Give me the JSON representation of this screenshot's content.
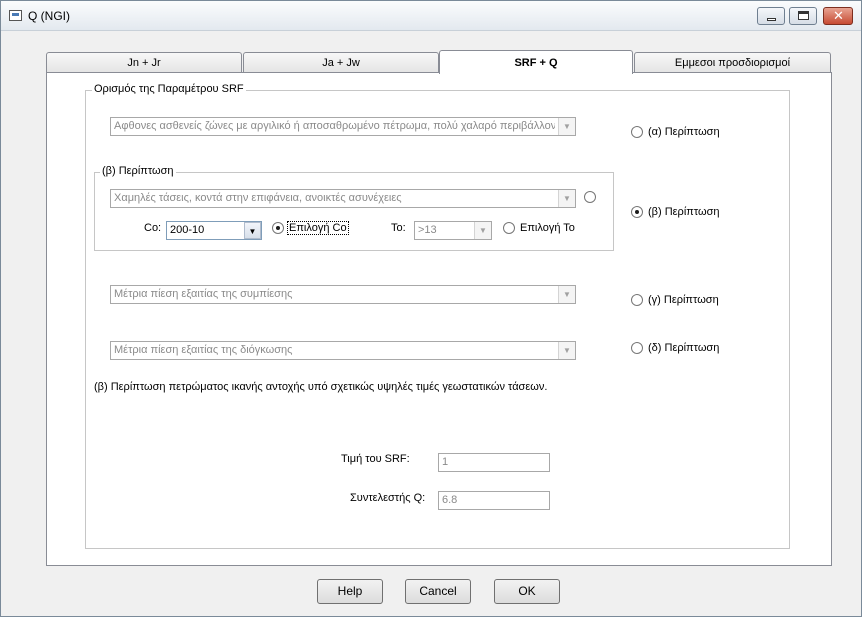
{
  "window": {
    "title": "Q (NGI)"
  },
  "tabs": [
    {
      "label": "Jn + Jr"
    },
    {
      "label": "Ja + Jw"
    },
    {
      "label": "SRF + Q"
    },
    {
      "label": "Εμμεσοι προσδιορισμοί"
    }
  ],
  "srf_group": {
    "title": "Ορισμός της Παραμέτρου SRF",
    "case_a": {
      "combo_value": "Αφθονες ασθενείς ζώνες με αργιλικό ή αποσαθρωμένο πέτρωμα, πολύ χαλαρό περιβάλλον",
      "radio_label": "(α) Περίπτωση",
      "checked": false
    },
    "case_b": {
      "group_title": "(β) Περίπτωση",
      "combo_value": "Χαμηλές τάσεις, κοντά στην επιφάνεια, ανοικτές ασυνέχειες",
      "co_label": "Co:",
      "co_value": "200-10",
      "co_radio_label": "Επιλογή Co",
      "co_checked": true,
      "to_label": "To:",
      "to_value": ">13",
      "to_radio_label": "Επιλογή Το",
      "to_checked": false,
      "radio_label": "(β) Περίπτωση",
      "checked": true
    },
    "case_c": {
      "combo_value": "Μέτρια πίεση εξαιτίας της συμπίεσης",
      "radio_label": "(γ) Περίπτωση",
      "checked": false
    },
    "case_d": {
      "combo_value": "Μέτρια πίεση εξαιτίας της διόγκωσης",
      "radio_label": "(δ) Περίπτωση",
      "checked": false
    },
    "description": "(β) Περίπτωση πετρώματος ικανής αντοχής υπό σχετικώς υψηλές τιμές γεωστατικών τάσεων.",
    "srf_value_label": "Τιμή του SRF:",
    "srf_value": "1",
    "q_label": "Συντελεστής Q:",
    "q_value": "6.8"
  },
  "buttons": {
    "help": "Help",
    "cancel": "Cancel",
    "ok": "OK"
  }
}
